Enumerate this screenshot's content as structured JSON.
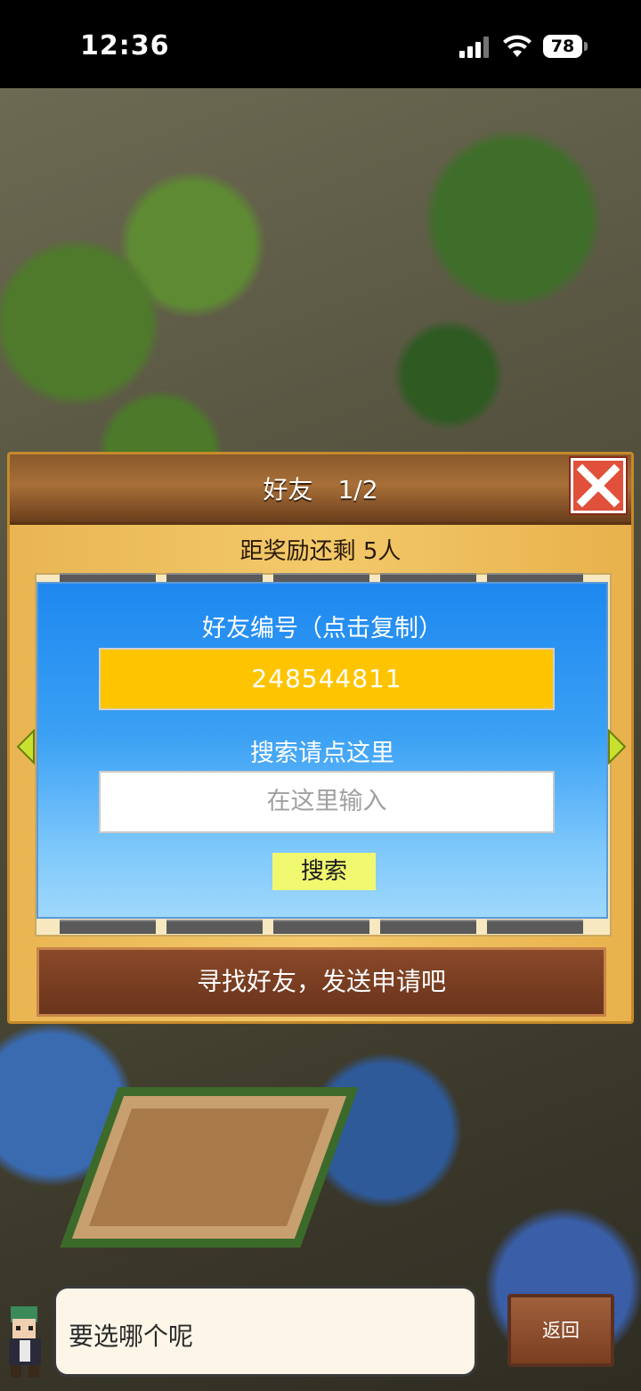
{
  "status_bar": {
    "time": "12:36",
    "battery": "78"
  },
  "dialog": {
    "title": "好友　1/2",
    "reward_text": "距奖励还剩 5人",
    "friend_id_label": "好友编号（点击复制）",
    "friend_id_value": "248544811",
    "search_label": "搜索请点这里",
    "search_placeholder": "在这里输入",
    "search_button": "搜索",
    "find_friends_button": "寻找好友，发送申请吧"
  },
  "bottom": {
    "speech_text": "要选哪个呢",
    "back_button": "返回"
  },
  "colors": {
    "id_box": "#ffc400",
    "panel_blue": "#1e88f0",
    "search_button": "#f0f870",
    "close_button": "#e0503a"
  }
}
